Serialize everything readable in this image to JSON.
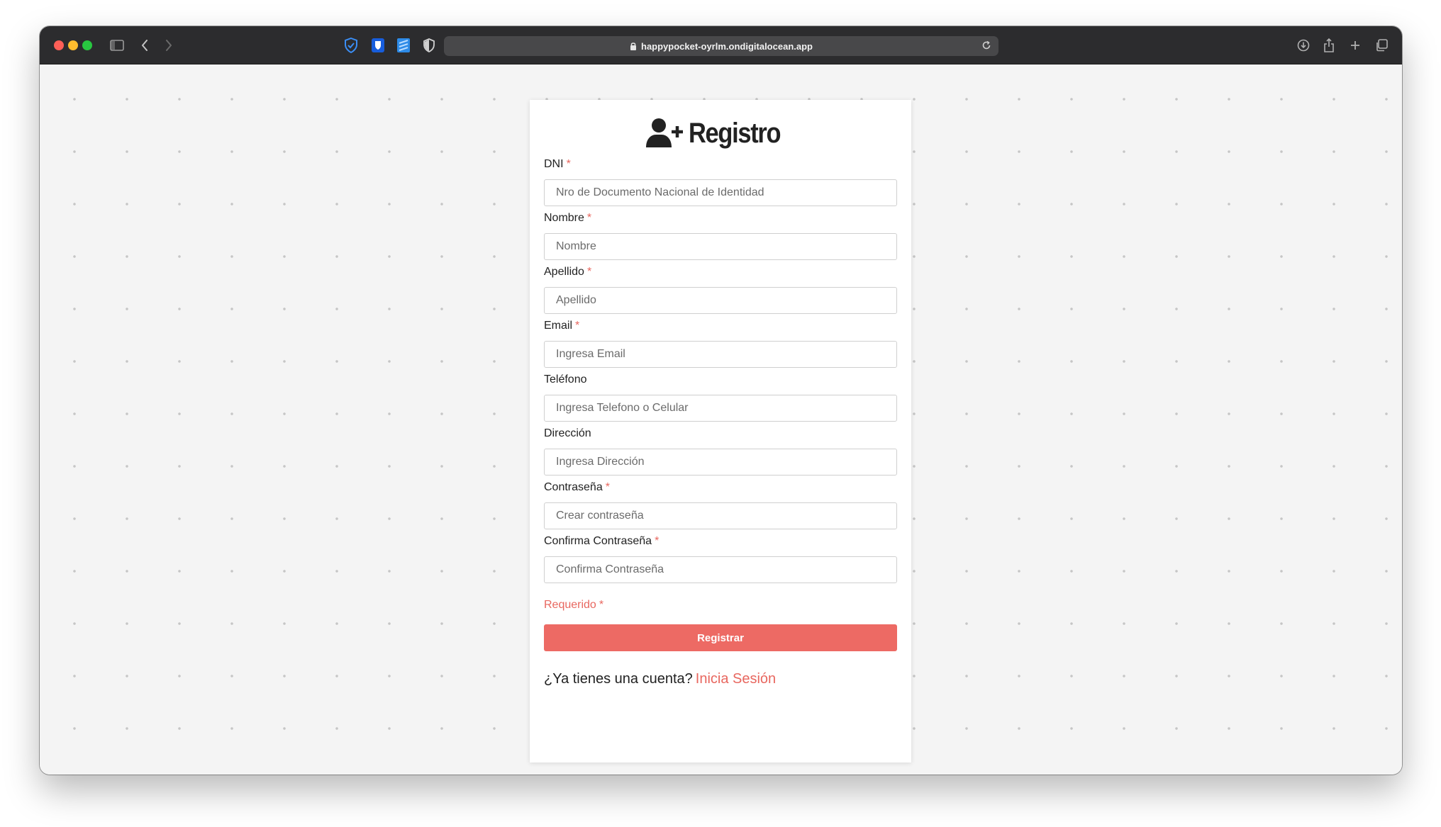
{
  "browser": {
    "url": "happypocket-oyrlm.ondigitalocean.app"
  },
  "form": {
    "title": "Registro",
    "fields": [
      {
        "label": "DNI",
        "required": "*",
        "placeholder": "Nro de Documento Nacional de Identidad"
      },
      {
        "label": "Nombre",
        "required": "*",
        "placeholder": "Nombre"
      },
      {
        "label": "Apellido",
        "required": "*",
        "placeholder": "Apellido"
      },
      {
        "label": "Email",
        "required": "*",
        "placeholder": "Ingresa Email"
      },
      {
        "label": "Teléfono",
        "required": "",
        "placeholder": "Ingresa Telefono o Celular"
      },
      {
        "label": "Dirección",
        "required": "",
        "placeholder": "Ingresa Dirección"
      },
      {
        "label": "Contraseña",
        "required": "*",
        "placeholder": "Crear contraseña"
      },
      {
        "label": "Confirma Contraseña",
        "required": "*",
        "placeholder": "Confirma Contraseña"
      }
    ],
    "required_note": "Requerido",
    "required_star": "*",
    "submit_label": "Registrar",
    "login_prompt": "¿Ya tienes una cuenta?",
    "login_link": "Inicia Sesión"
  },
  "colors": {
    "accent": "#ed6a64",
    "required": "#e8675f",
    "toolbar": "#2c2c2e"
  },
  "icons": {
    "title": "user-plus-icon",
    "toolbar": [
      "sidebar-icon",
      "back-icon",
      "forward-icon",
      "shield-check-icon",
      "bitwarden-icon",
      "todo-extension-icon",
      "privacy-shield-icon",
      "lock-icon",
      "reload-icon",
      "download-icon",
      "share-icon",
      "new-tab-icon",
      "tabs-overview-icon"
    ]
  }
}
